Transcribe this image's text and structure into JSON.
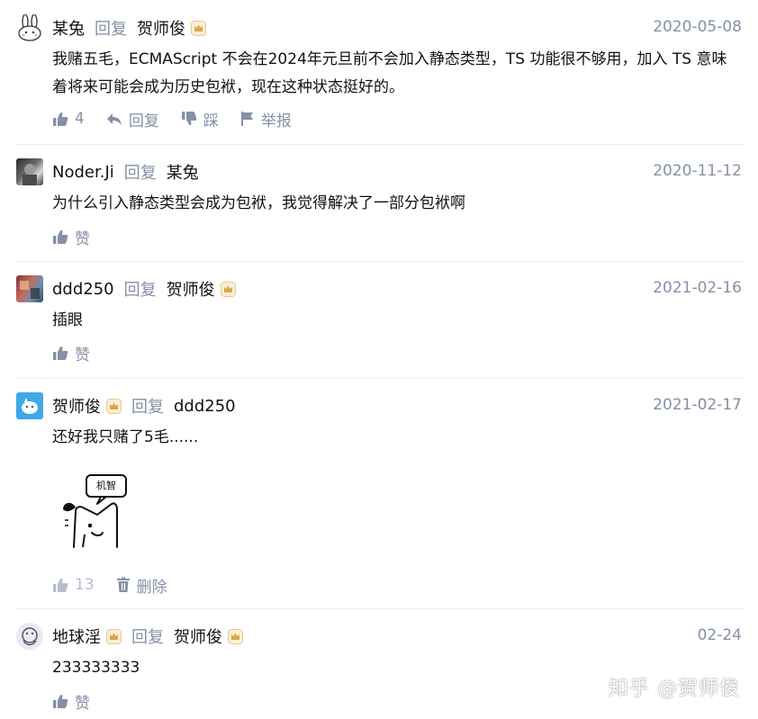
{
  "comments": [
    {
      "author": "某兔",
      "reply_word": "回复",
      "reply_to": "贺师俊",
      "date": "2020-05-08",
      "text": "我赌五毛，ECMAScript 不会在2024年元旦前不会加入静态类型，TS 功能很不够用，加入 TS 意味着将来可能会成为历史包袱，现在这种状态挺好的。",
      "like_count": "4",
      "reply_label": "回复",
      "dislike_label": "踩",
      "report_label": "举报"
    },
    {
      "author": "Noder.Ji",
      "reply_word": "回复",
      "reply_to": "某兔",
      "date": "2020-11-12",
      "text": "为什么引入静态类型会成为包袱，我觉得解决了一部分包袱啊",
      "like_label": "赞"
    },
    {
      "author": "ddd250",
      "reply_word": "回复",
      "reply_to": "贺师俊",
      "date": "2021-02-16",
      "text": "插眼",
      "like_label": "赞"
    },
    {
      "author": "贺师俊",
      "reply_word": "回复",
      "reply_to": "ddd250",
      "date": "2021-02-17",
      "text": "还好我只赌了5毛......",
      "sticker_text": "机智",
      "like_count": "13",
      "delete_label": "删除"
    },
    {
      "author": "地球淫",
      "reply_word": "回复",
      "reply_to": "贺师俊",
      "date": "02-24",
      "text": "233333333",
      "like_label": "赞"
    }
  ],
  "watermark": "知乎 @贺师俊",
  "colors": {
    "text": "#121212",
    "meta": "#8590a6",
    "disabled": "#b5bdcb",
    "divider": "#ebebeb",
    "badge": "#d9a64a"
  }
}
